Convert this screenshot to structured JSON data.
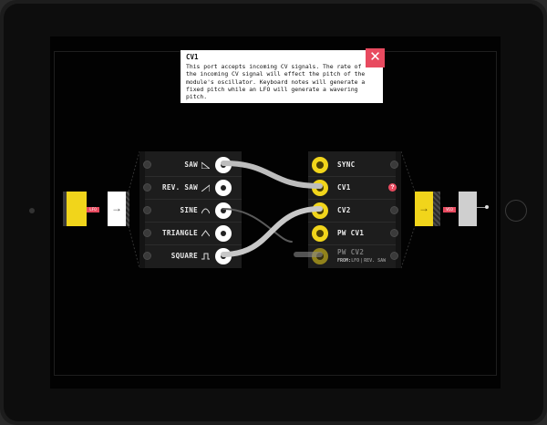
{
  "tooltip": {
    "title": "CV1",
    "body": "This port accepts incoming CV signals. The rate of the incoming CV signal will effect the pitch of the module's oscillator. Keyboard notes will generate a fixed pitch while an LFO will generate a wavering pitch.",
    "close_icon": "close-icon"
  },
  "lfo": {
    "badge": "LFO",
    "outputs": [
      {
        "label": "SAW",
        "icon": "saw-wave-icon"
      },
      {
        "label": "REV. SAW",
        "icon": "rev-saw-wave-icon"
      },
      {
        "label": "SINE",
        "icon": "sine-wave-icon"
      },
      {
        "label": "TRIANGLE",
        "icon": "triangle-wave-icon"
      },
      {
        "label": "SQUARE",
        "icon": "square-wave-icon"
      }
    ]
  },
  "vco": {
    "badge": "VCO",
    "inputs": [
      {
        "label": "SYNC"
      },
      {
        "label": "CV1",
        "help": "?"
      },
      {
        "label": "CV2"
      },
      {
        "label": "PW CV1"
      },
      {
        "label": "PW CV2"
      }
    ],
    "from_prefix": "FROM:",
    "from_source": "LFO",
    "from_divider": "|",
    "from_output": "REV. SAW"
  },
  "colors": {
    "accent_yellow": "#f1d51b",
    "accent_red": "#e84a5f",
    "panel": "#1d1d1d",
    "background": "#020202"
  }
}
